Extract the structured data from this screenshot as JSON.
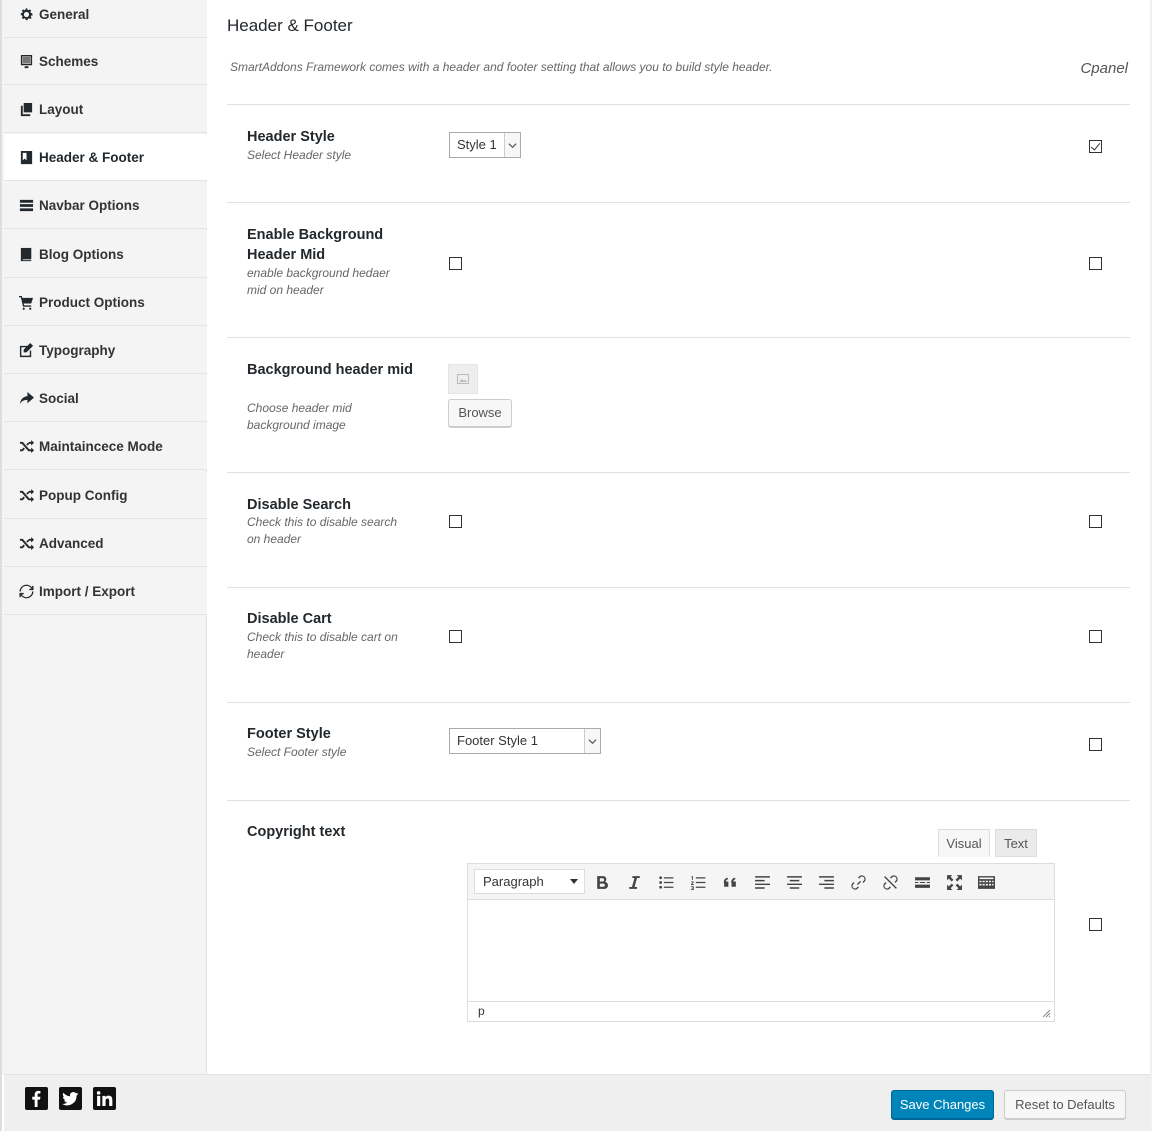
{
  "sidebar": {
    "items": [
      {
        "label": "General",
        "icon": "gear-icon"
      },
      {
        "label": "Schemes",
        "icon": "monitor-icon"
      },
      {
        "label": "Layout",
        "icon": "copy-icon"
      },
      {
        "label": "Header & Footer",
        "icon": "bookmark-icon",
        "active": true
      },
      {
        "label": "Navbar Options",
        "icon": "menu-icon"
      },
      {
        "label": "Blog Options",
        "icon": "book-icon"
      },
      {
        "label": "Product Options",
        "icon": "cart-icon"
      },
      {
        "label": "Typography",
        "icon": "edit-icon"
      },
      {
        "label": "Social",
        "icon": "share-icon"
      },
      {
        "label": "Maintaincece Mode",
        "icon": "shuffle-icon"
      },
      {
        "label": "Popup Config",
        "icon": "shuffle-icon"
      },
      {
        "label": "Advanced",
        "icon": "shuffle-icon"
      },
      {
        "label": "Import / Export",
        "icon": "refresh-icon"
      }
    ]
  },
  "section": {
    "title": "Header & Footer",
    "description": "SmartAddons Framework comes with a header and footer setting that allows you to build style header.",
    "cpanel": "Cpanel"
  },
  "fields": {
    "header_style": {
      "label": "Header Style",
      "sub": "Select Header style",
      "value": "Style 1",
      "cpanel_checked": true
    },
    "enable_bg_header_mid": {
      "label": "Enable Background Header Mid",
      "sub": "enable background hedaer mid on header",
      "checked": false,
      "cpanel_checked": false
    },
    "bg_header_mid": {
      "label": "Background header mid",
      "sub": "Choose header mid background image",
      "browse_label": "Browse"
    },
    "disable_search": {
      "label": "Disable Search",
      "sub": "Check this to disable search on header",
      "checked": false,
      "cpanel_checked": false
    },
    "disable_cart": {
      "label": "Disable Cart",
      "sub": "Check this to disable cart on header",
      "checked": false,
      "cpanel_checked": false
    },
    "footer_style": {
      "label": "Footer Style",
      "sub": "Select Footer style",
      "value": "Footer Style 1",
      "cpanel_checked": false
    },
    "copyright_text": {
      "label": "Copyright text",
      "tab_visual": "Visual",
      "tab_text": "Text",
      "format": "Paragraph",
      "content": "",
      "status_path": "p",
      "cpanel_checked": false
    }
  },
  "footer": {
    "social": [
      "facebook-icon",
      "twitter-icon",
      "linkedin-icon"
    ],
    "save_label": "Save Changes",
    "reset_label": "Reset to Defaults"
  },
  "colors": {
    "primary_button": "#0085ba",
    "sidebar_bg": "#f4f4f4",
    "footer_bg": "#efefef"
  }
}
